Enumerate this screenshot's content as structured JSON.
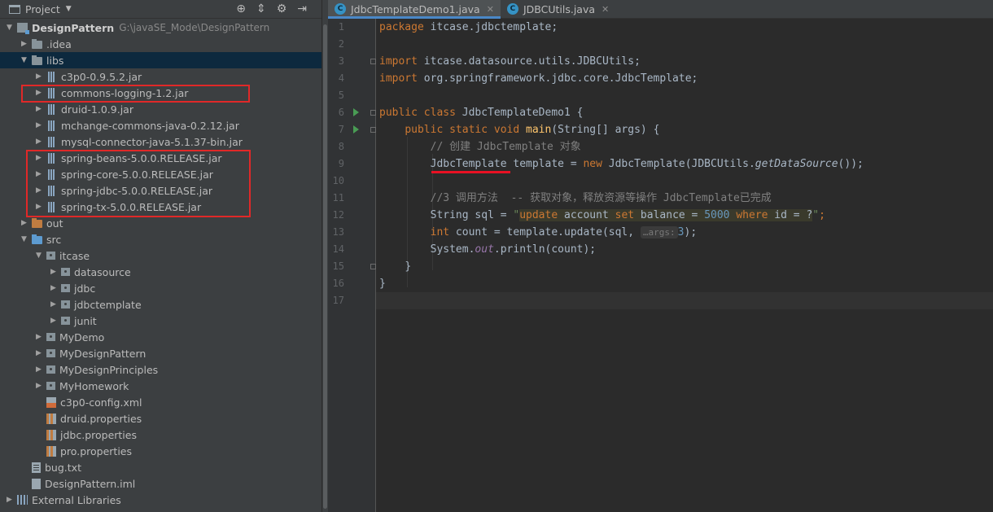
{
  "project_panel": {
    "title": "Project",
    "tree": [
      {
        "label": "DesignPattern",
        "path": "G:\\javaSE_Mode\\DesignPattern",
        "level": 0,
        "expanded": true,
        "icon": "project-folder-icon",
        "bold": true
      },
      {
        "label": ".idea",
        "level": 1,
        "expanded": false,
        "icon": "folder-icon"
      },
      {
        "label": "libs",
        "level": 1,
        "expanded": true,
        "icon": "folder-icon",
        "selected": true
      },
      {
        "label": "c3p0-0.9.5.2.jar",
        "level": 2,
        "expanded": false,
        "icon": "jar-icon"
      },
      {
        "label": "commons-logging-1.2.jar",
        "level": 2,
        "expanded": false,
        "icon": "jar-icon"
      },
      {
        "label": "druid-1.0.9.jar",
        "level": 2,
        "expanded": false,
        "icon": "jar-icon"
      },
      {
        "label": "mchange-commons-java-0.2.12.jar",
        "level": 2,
        "expanded": false,
        "icon": "jar-icon"
      },
      {
        "label": "mysql-connector-java-5.1.37-bin.jar",
        "level": 2,
        "expanded": false,
        "icon": "jar-icon"
      },
      {
        "label": "spring-beans-5.0.0.RELEASE.jar",
        "level": 2,
        "expanded": false,
        "icon": "jar-icon"
      },
      {
        "label": "spring-core-5.0.0.RELEASE.jar",
        "level": 2,
        "expanded": false,
        "icon": "jar-icon"
      },
      {
        "label": "spring-jdbc-5.0.0.RELEASE.jar",
        "level": 2,
        "expanded": false,
        "icon": "jar-icon"
      },
      {
        "label": "spring-tx-5.0.0.RELEASE.jar",
        "level": 2,
        "expanded": false,
        "icon": "jar-icon"
      },
      {
        "label": "out",
        "level": 1,
        "expanded": false,
        "icon": "output-folder-icon"
      },
      {
        "label": "src",
        "level": 1,
        "expanded": true,
        "icon": "source-folder-icon"
      },
      {
        "label": "itcase",
        "level": 2,
        "expanded": true,
        "icon": "package-icon"
      },
      {
        "label": "datasource",
        "level": 3,
        "expanded": false,
        "icon": "package-icon"
      },
      {
        "label": "jdbc",
        "level": 3,
        "expanded": false,
        "icon": "package-icon"
      },
      {
        "label": "jdbctemplate",
        "level": 3,
        "expanded": false,
        "icon": "package-icon"
      },
      {
        "label": "junit",
        "level": 3,
        "expanded": false,
        "icon": "package-icon"
      },
      {
        "label": "MyDemo",
        "level": 2,
        "expanded": false,
        "icon": "package-icon"
      },
      {
        "label": "MyDesignPattern",
        "level": 2,
        "expanded": false,
        "icon": "package-icon"
      },
      {
        "label": "MyDesignPrinciples",
        "level": 2,
        "expanded": false,
        "icon": "package-icon"
      },
      {
        "label": "MyHomework",
        "level": 2,
        "expanded": false,
        "icon": "package-icon"
      },
      {
        "label": "c3p0-config.xml",
        "level": 2,
        "leaf": true,
        "icon": "xml-file-icon"
      },
      {
        "label": "druid.properties",
        "level": 2,
        "leaf": true,
        "icon": "properties-file-icon"
      },
      {
        "label": "jdbc.properties",
        "level": 2,
        "leaf": true,
        "icon": "properties-file-icon"
      },
      {
        "label": "pro.properties",
        "level": 2,
        "leaf": true,
        "icon": "properties-file-icon"
      },
      {
        "label": "bug.txt",
        "level": 1,
        "leaf": true,
        "icon": "text-file-icon"
      },
      {
        "label": "DesignPattern.iml",
        "level": 1,
        "leaf": true,
        "icon": "module-file-icon"
      },
      {
        "label": "External Libraries",
        "level": 0,
        "expanded": false,
        "icon": "external-libraries-icon"
      }
    ]
  },
  "editor": {
    "tabs": [
      {
        "label": "JdbcTemplateDemo1.java",
        "active": true
      },
      {
        "label": "JDBCUtils.java",
        "active": false
      }
    ],
    "line_numbers": [
      "1",
      "2",
      "3",
      "4",
      "5",
      "6",
      "7",
      "8",
      "9",
      "10",
      "11",
      "12",
      "13",
      "14",
      "15",
      "16",
      "17"
    ],
    "code": {
      "l1": {
        "kw": "package",
        "rest": " itcase.jdbctemplate;"
      },
      "l3": {
        "kw": "import",
        "rest": " itcase.datasource.utils.JDBCUtils;"
      },
      "l4": {
        "kw": "import",
        "rest": " org.springframework.jdbc.core.JdbcTemplate;"
      },
      "l6": {
        "kw": "public class",
        "rest": " JdbcTemplateDemo1 {"
      },
      "l7": {
        "indent": "    ",
        "kw": "public static void",
        "name": " main",
        "rest": "(String[] args) {"
      },
      "l8": {
        "indent": "        ",
        "comment": "// 创建 JdbcTemplate 对象"
      },
      "l9": {
        "indent": "        ",
        "type": "JdbcTemplate",
        "a": " template = ",
        "kw": "new",
        "b": " JdbcTemplate(JDBCUtils.",
        "method": "getDataSource",
        "c": "());"
      },
      "l11": {
        "indent": "        ",
        "comment": "//3 调用方法  -- 获取对象，释放资源等操作 JdbcTemplate已完成"
      },
      "l12": {
        "indent": "        ",
        "a": "String sql = ",
        "q1": "\"",
        "s1": "update",
        "s2": " account ",
        "s3": "set",
        "s4": " balance = ",
        "n1": "5000",
        "s5": " ",
        "s6": "where",
        "s7": " id = ?",
        "q2": "\"",
        "b": ";"
      },
      "l13": {
        "indent": "        ",
        "kw": "int",
        "a": " count = template.update(sql, ",
        "hint": "…args:",
        "num": "3",
        "b": ");"
      },
      "l14": {
        "indent": "        ",
        "a": "System.",
        "field": "out",
        "b": ".println(count);"
      },
      "l15": {
        "indent": "    ",
        "a": "}"
      },
      "l16": {
        "a": "}"
      }
    },
    "run_lines": [
      "6",
      "7"
    ],
    "current_line": "17"
  },
  "colors": {
    "keyword": "#cc7832",
    "string": "#6a8759",
    "number": "#6897bb",
    "comment": "#808080",
    "annotation_highlight": "#e02828"
  }
}
